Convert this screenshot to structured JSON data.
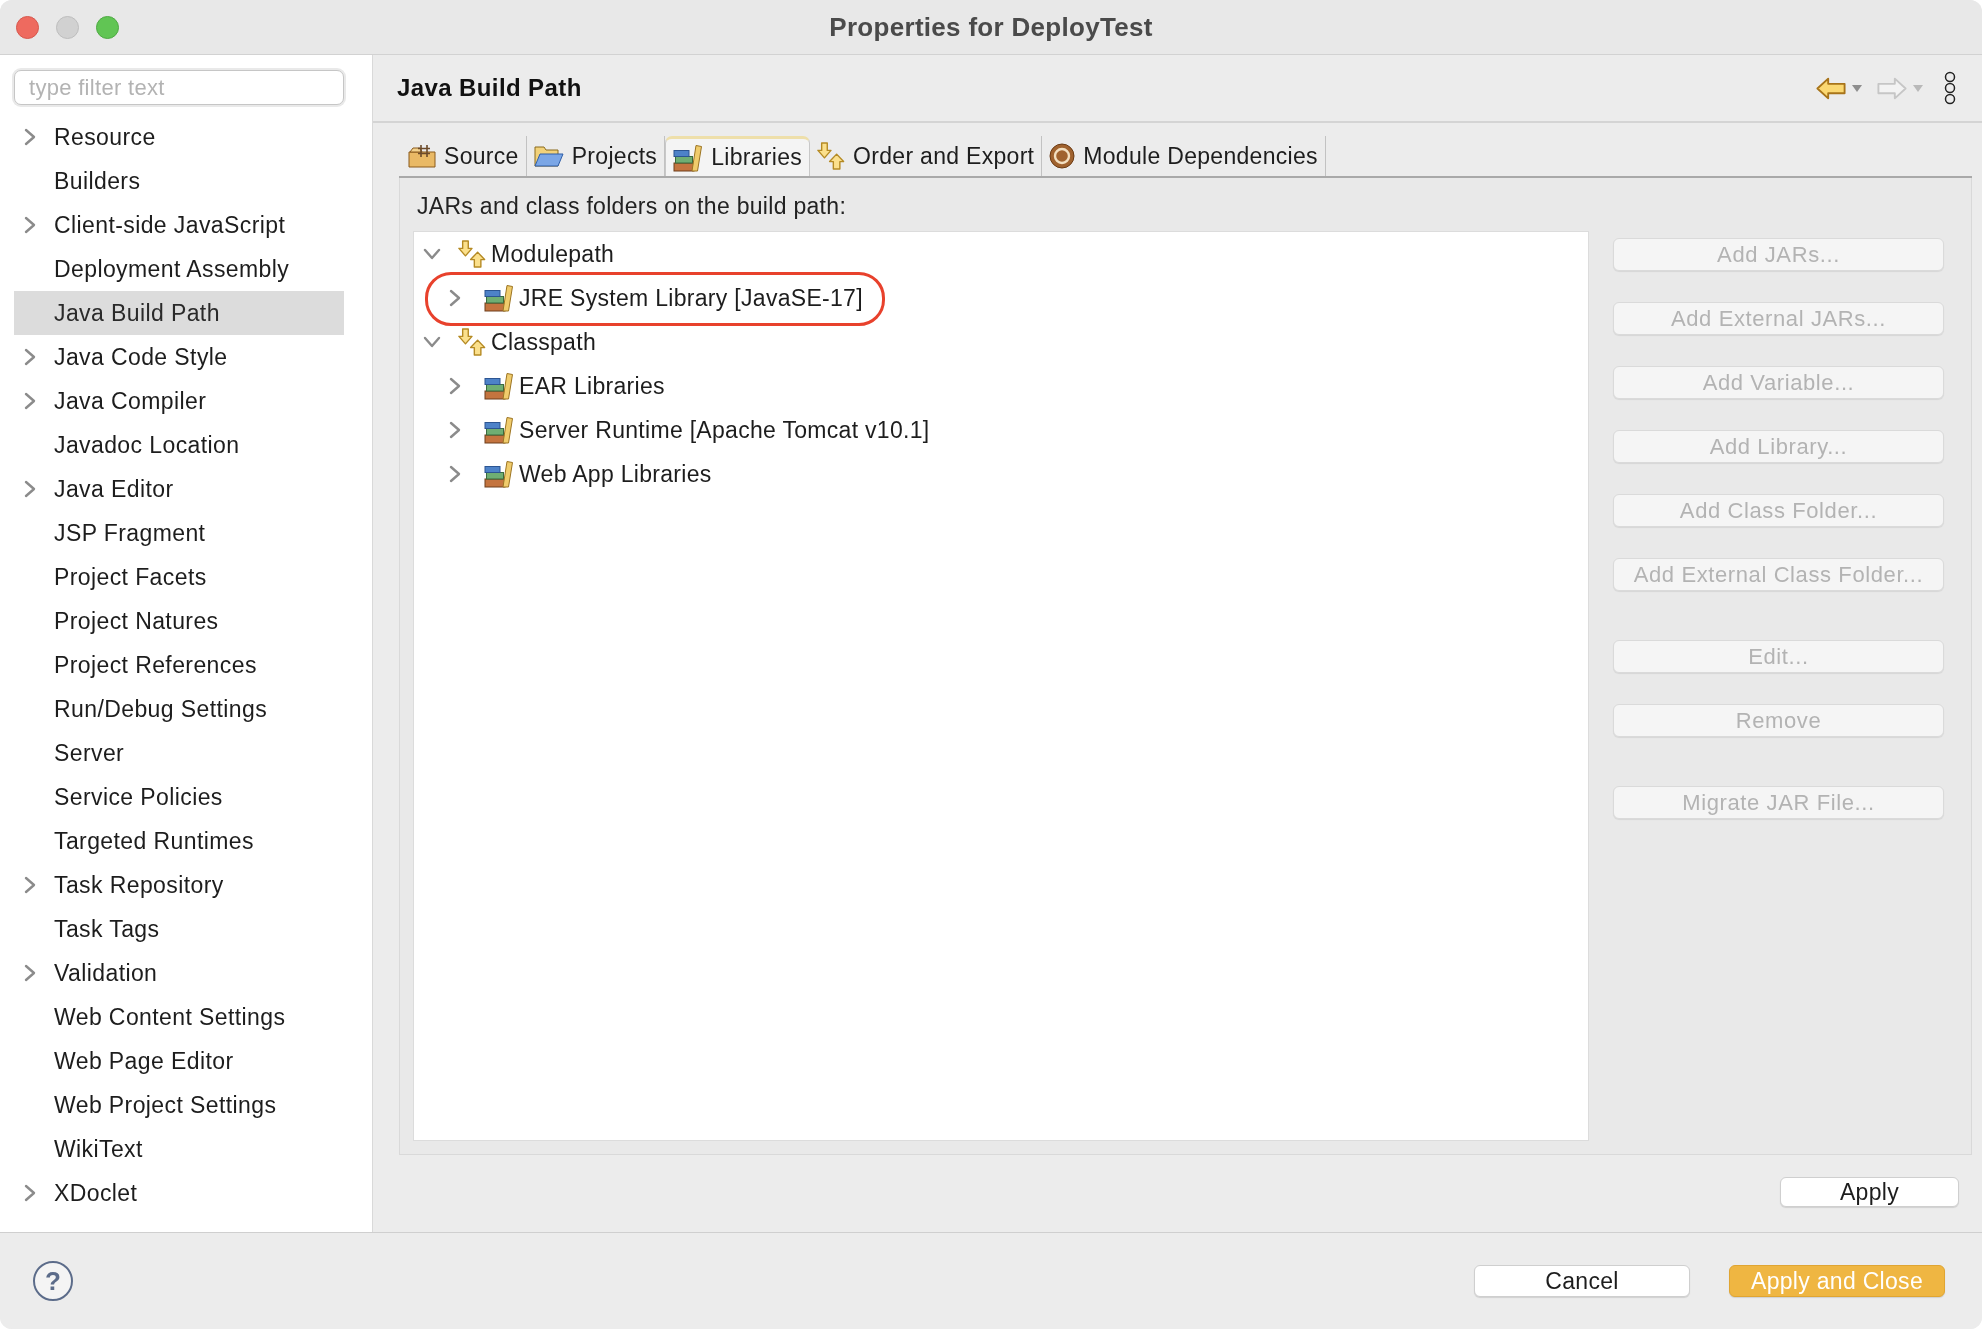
{
  "window": {
    "title": "Properties for DeployTest",
    "controls": [
      {
        "kind": "close",
        "disabled": false
      },
      {
        "kind": "minimize",
        "disabled": true
      },
      {
        "kind": "zoom",
        "disabled": false
      }
    ]
  },
  "sidebar": {
    "filter": {
      "placeholder": "type filter text"
    },
    "items": [
      {
        "label": "Resource",
        "expandable": true,
        "selected": false
      },
      {
        "label": "Builders",
        "expandable": false,
        "selected": false
      },
      {
        "label": "Client-side JavaScript",
        "expandable": true,
        "selected": false
      },
      {
        "label": "Deployment Assembly",
        "expandable": false,
        "selected": false
      },
      {
        "label": "Java Build Path",
        "expandable": false,
        "selected": true
      },
      {
        "label": "Java Code Style",
        "expandable": true,
        "selected": false
      },
      {
        "label": "Java Compiler",
        "expandable": true,
        "selected": false
      },
      {
        "label": "Javadoc Location",
        "expandable": false,
        "selected": false
      },
      {
        "label": "Java Editor",
        "expandable": true,
        "selected": false
      },
      {
        "label": "JSP Fragment",
        "expandable": false,
        "selected": false
      },
      {
        "label": "Project Facets",
        "expandable": false,
        "selected": false
      },
      {
        "label": "Project Natures",
        "expandable": false,
        "selected": false
      },
      {
        "label": "Project References",
        "expandable": false,
        "selected": false
      },
      {
        "label": "Run/Debug Settings",
        "expandable": false,
        "selected": false
      },
      {
        "label": "Server",
        "expandable": false,
        "selected": false
      },
      {
        "label": "Service Policies",
        "expandable": false,
        "selected": false
      },
      {
        "label": "Targeted Runtimes",
        "expandable": false,
        "selected": false
      },
      {
        "label": "Task Repository",
        "expandable": true,
        "selected": false
      },
      {
        "label": "Task Tags",
        "expandable": false,
        "selected": false
      },
      {
        "label": "Validation",
        "expandable": true,
        "selected": false
      },
      {
        "label": "Web Content Settings",
        "expandable": false,
        "selected": false
      },
      {
        "label": "Web Page Editor",
        "expandable": false,
        "selected": false
      },
      {
        "label": "Web Project Settings",
        "expandable": false,
        "selected": false
      },
      {
        "label": "WikiText",
        "expandable": false,
        "selected": false
      },
      {
        "label": "XDoclet",
        "expandable": true,
        "selected": false
      }
    ]
  },
  "page": {
    "title": "Java Build Path",
    "nav": [
      {
        "kind": "back",
        "disabled": false
      },
      {
        "kind": "forward",
        "disabled": true
      }
    ]
  },
  "tabs": [
    {
      "label": "Source",
      "kind": "source",
      "selected": false
    },
    {
      "label": "Projects",
      "kind": "projects",
      "selected": false
    },
    {
      "label": "Libraries",
      "kind": "libraries",
      "selected": true
    },
    {
      "label": "Order and Export",
      "kind": "order",
      "selected": false
    },
    {
      "label": "Module Dependencies",
      "kind": "modules",
      "selected": false
    }
  ],
  "libraries": {
    "caption": "JARs and class folders on the build path:",
    "tree": [
      {
        "label": "Modulepath",
        "kind": "path",
        "expanded": true,
        "circled": false,
        "children": [
          {
            "label": "JRE System Library [JavaSE-17]",
            "kind": "library",
            "expanded": false,
            "circled": true
          }
        ]
      },
      {
        "label": "Classpath",
        "kind": "path",
        "expanded": true,
        "circled": false,
        "children": [
          {
            "label": "EAR Libraries",
            "kind": "library",
            "expanded": false,
            "circled": false
          },
          {
            "label": "Server Runtime [Apache Tomcat v10.1]",
            "kind": "library",
            "expanded": false,
            "circled": false
          },
          {
            "label": "Web App Libraries",
            "kind": "library",
            "expanded": false,
            "circled": false
          }
        ]
      }
    ],
    "button_groups": [
      [
        {
          "label": "Add JARs...",
          "disabled": true
        },
        {
          "label": "Add External JARs...",
          "disabled": true
        },
        {
          "label": "Add Variable...",
          "disabled": true
        },
        {
          "label": "Add Library...",
          "disabled": true
        },
        {
          "label": "Add Class Folder...",
          "disabled": true
        },
        {
          "label": "Add External Class Folder...",
          "disabled": true
        }
      ],
      [
        {
          "label": "Edit...",
          "disabled": true
        },
        {
          "label": "Remove",
          "disabled": true
        }
      ],
      [
        {
          "label": "Migrate JAR File...",
          "disabled": true
        }
      ]
    ]
  },
  "apply_button": {
    "label": "Apply"
  },
  "footer": {
    "help": "?",
    "buttons": [
      {
        "label": "Cancel",
        "kind": "normal"
      },
      {
        "label": "Apply and Close",
        "kind": "default"
      }
    ]
  }
}
